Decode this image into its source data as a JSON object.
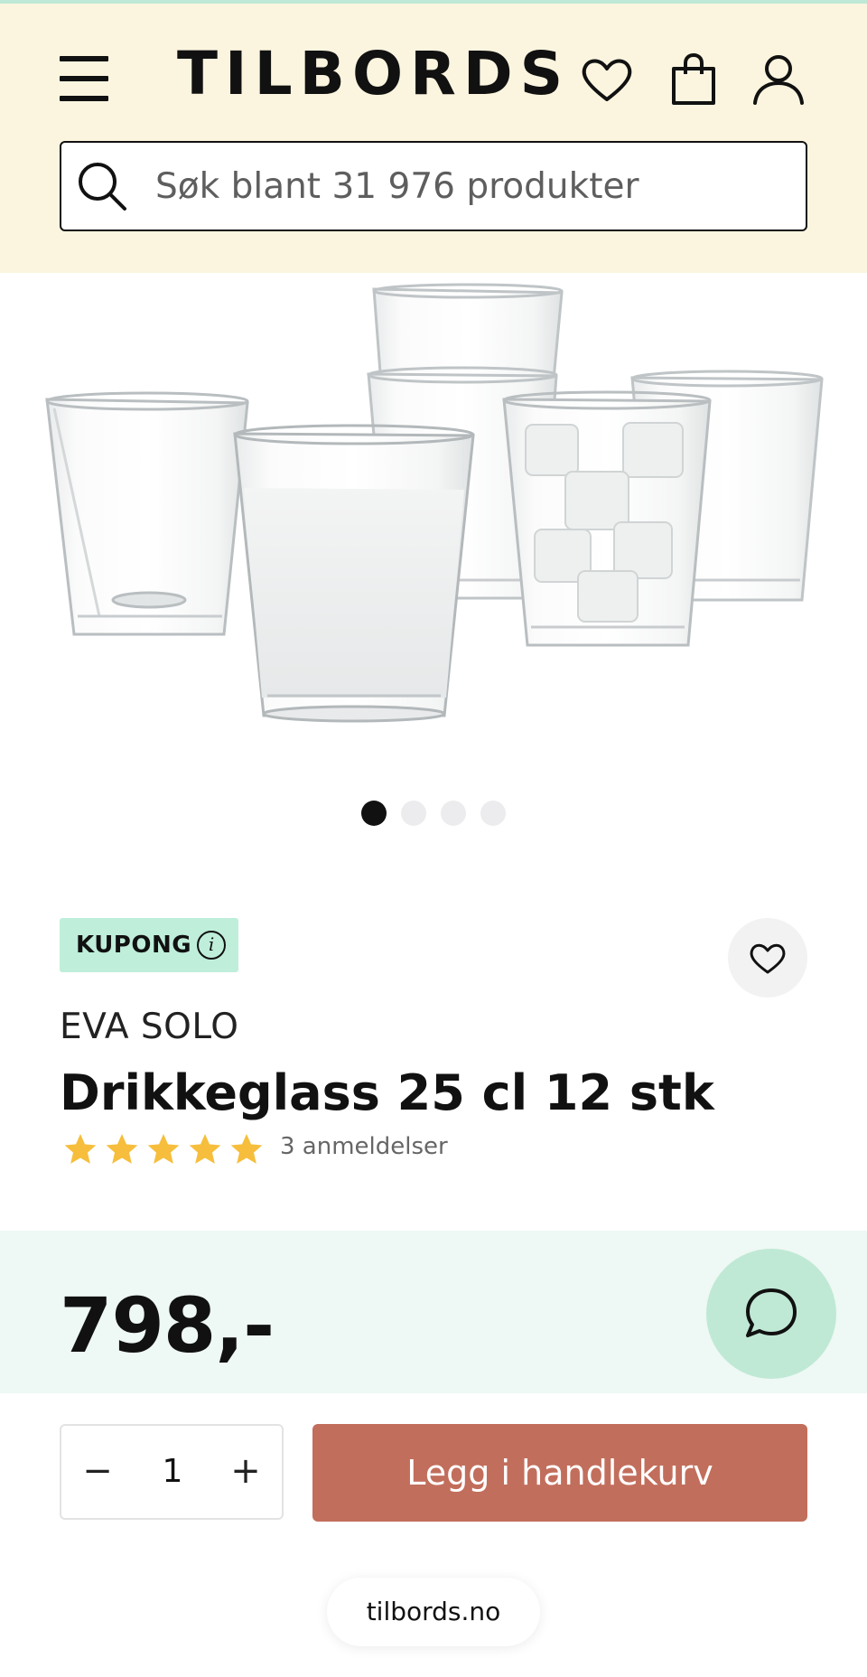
{
  "header": {
    "logo": "TILBORDS",
    "icons": [
      "menu-icon",
      "heart-icon",
      "shopping-bag-icon",
      "user-icon"
    ],
    "background": "#fbf5df"
  },
  "search": {
    "placeholder": "Søk blant 31 976 produkter"
  },
  "gallery": {
    "image": "drinking-glasses-photo",
    "slide_count": 4,
    "active_slide": 1
  },
  "product": {
    "badge": "KUPONG",
    "brand": "EVA SOLO",
    "title": "Drikkeglass 25 cl 12 stk",
    "rating": 5,
    "reviews": "3 anmeldelser",
    "price": "798,-"
  },
  "cart": {
    "quantity": "1",
    "minus": "−",
    "plus": "+",
    "add_label": "Legg i handlekurv"
  },
  "footer": {
    "url": "tilbords.no"
  },
  "colors": {
    "accent_green": "#bfe9d5",
    "price_band": "#eef8f4",
    "add_button": "#c26e5c",
    "star": "#f6be3c"
  }
}
